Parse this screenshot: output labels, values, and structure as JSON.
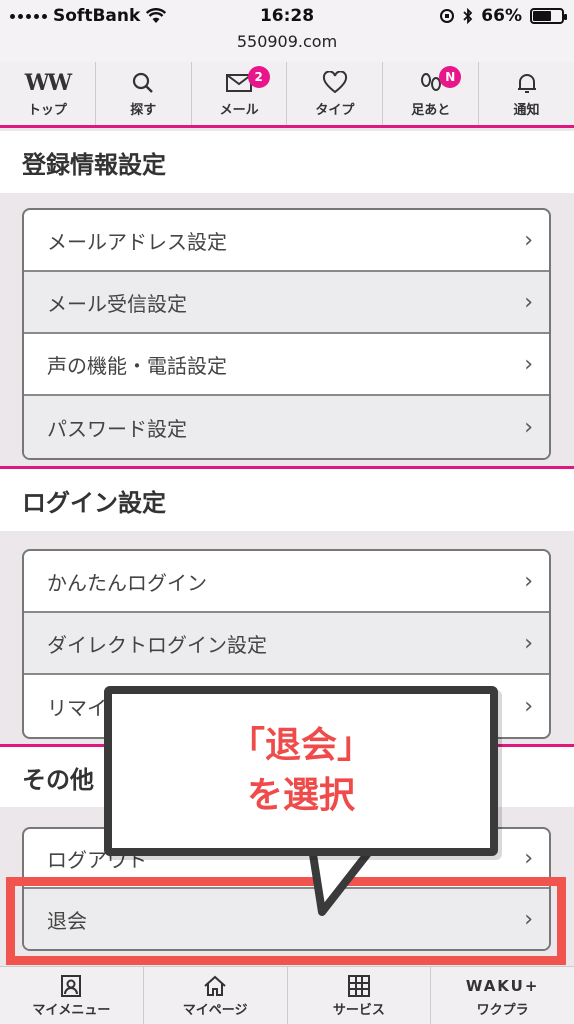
{
  "status_bar": {
    "carrier": "SoftBank",
    "time": "16:28",
    "battery": "66%",
    "battery_level": 0.66,
    "url": "550909.com"
  },
  "top_nav": {
    "items": [
      {
        "label": "トップ",
        "icon": "ww-logo"
      },
      {
        "label": "探す",
        "icon": "search-icon"
      },
      {
        "label": "メール",
        "icon": "mail-icon",
        "badge": "2"
      },
      {
        "label": "タイプ",
        "icon": "heart-icon"
      },
      {
        "label": "足あと",
        "icon": "footprint-icon",
        "badge": "N"
      },
      {
        "label": "通知",
        "icon": "bell-icon"
      }
    ],
    "logo_text": "WW"
  },
  "sections": [
    {
      "title": "登録情報設定",
      "items": [
        "メールアドレス設定",
        "メール受信設定",
        "声の機能・電話設定",
        "パスワード設定"
      ]
    },
    {
      "title": "ログイン設定",
      "items": [
        "かんたんログイン",
        "ダイレクトログイン設定",
        "リマイ"
      ]
    },
    {
      "title": "その他",
      "items": [
        "ログアウト",
        "退会"
      ]
    }
  ],
  "chevron": "›",
  "callout": {
    "line1": "「退会」",
    "line2": "を選択"
  },
  "bottom_nav": {
    "items": [
      {
        "label": "マイメニュー",
        "icon": "profile-icon"
      },
      {
        "label": "マイページ",
        "icon": "home-icon"
      },
      {
        "label": "サービス",
        "icon": "grid-icon"
      },
      {
        "label": "ワクプラ",
        "icon": "wakuplus-logo",
        "logo_text": "WAKU+"
      }
    ]
  },
  "colors": {
    "accent": "#e0177f",
    "highlight": "#f1534f",
    "callout_text": "#ef4b4b"
  }
}
